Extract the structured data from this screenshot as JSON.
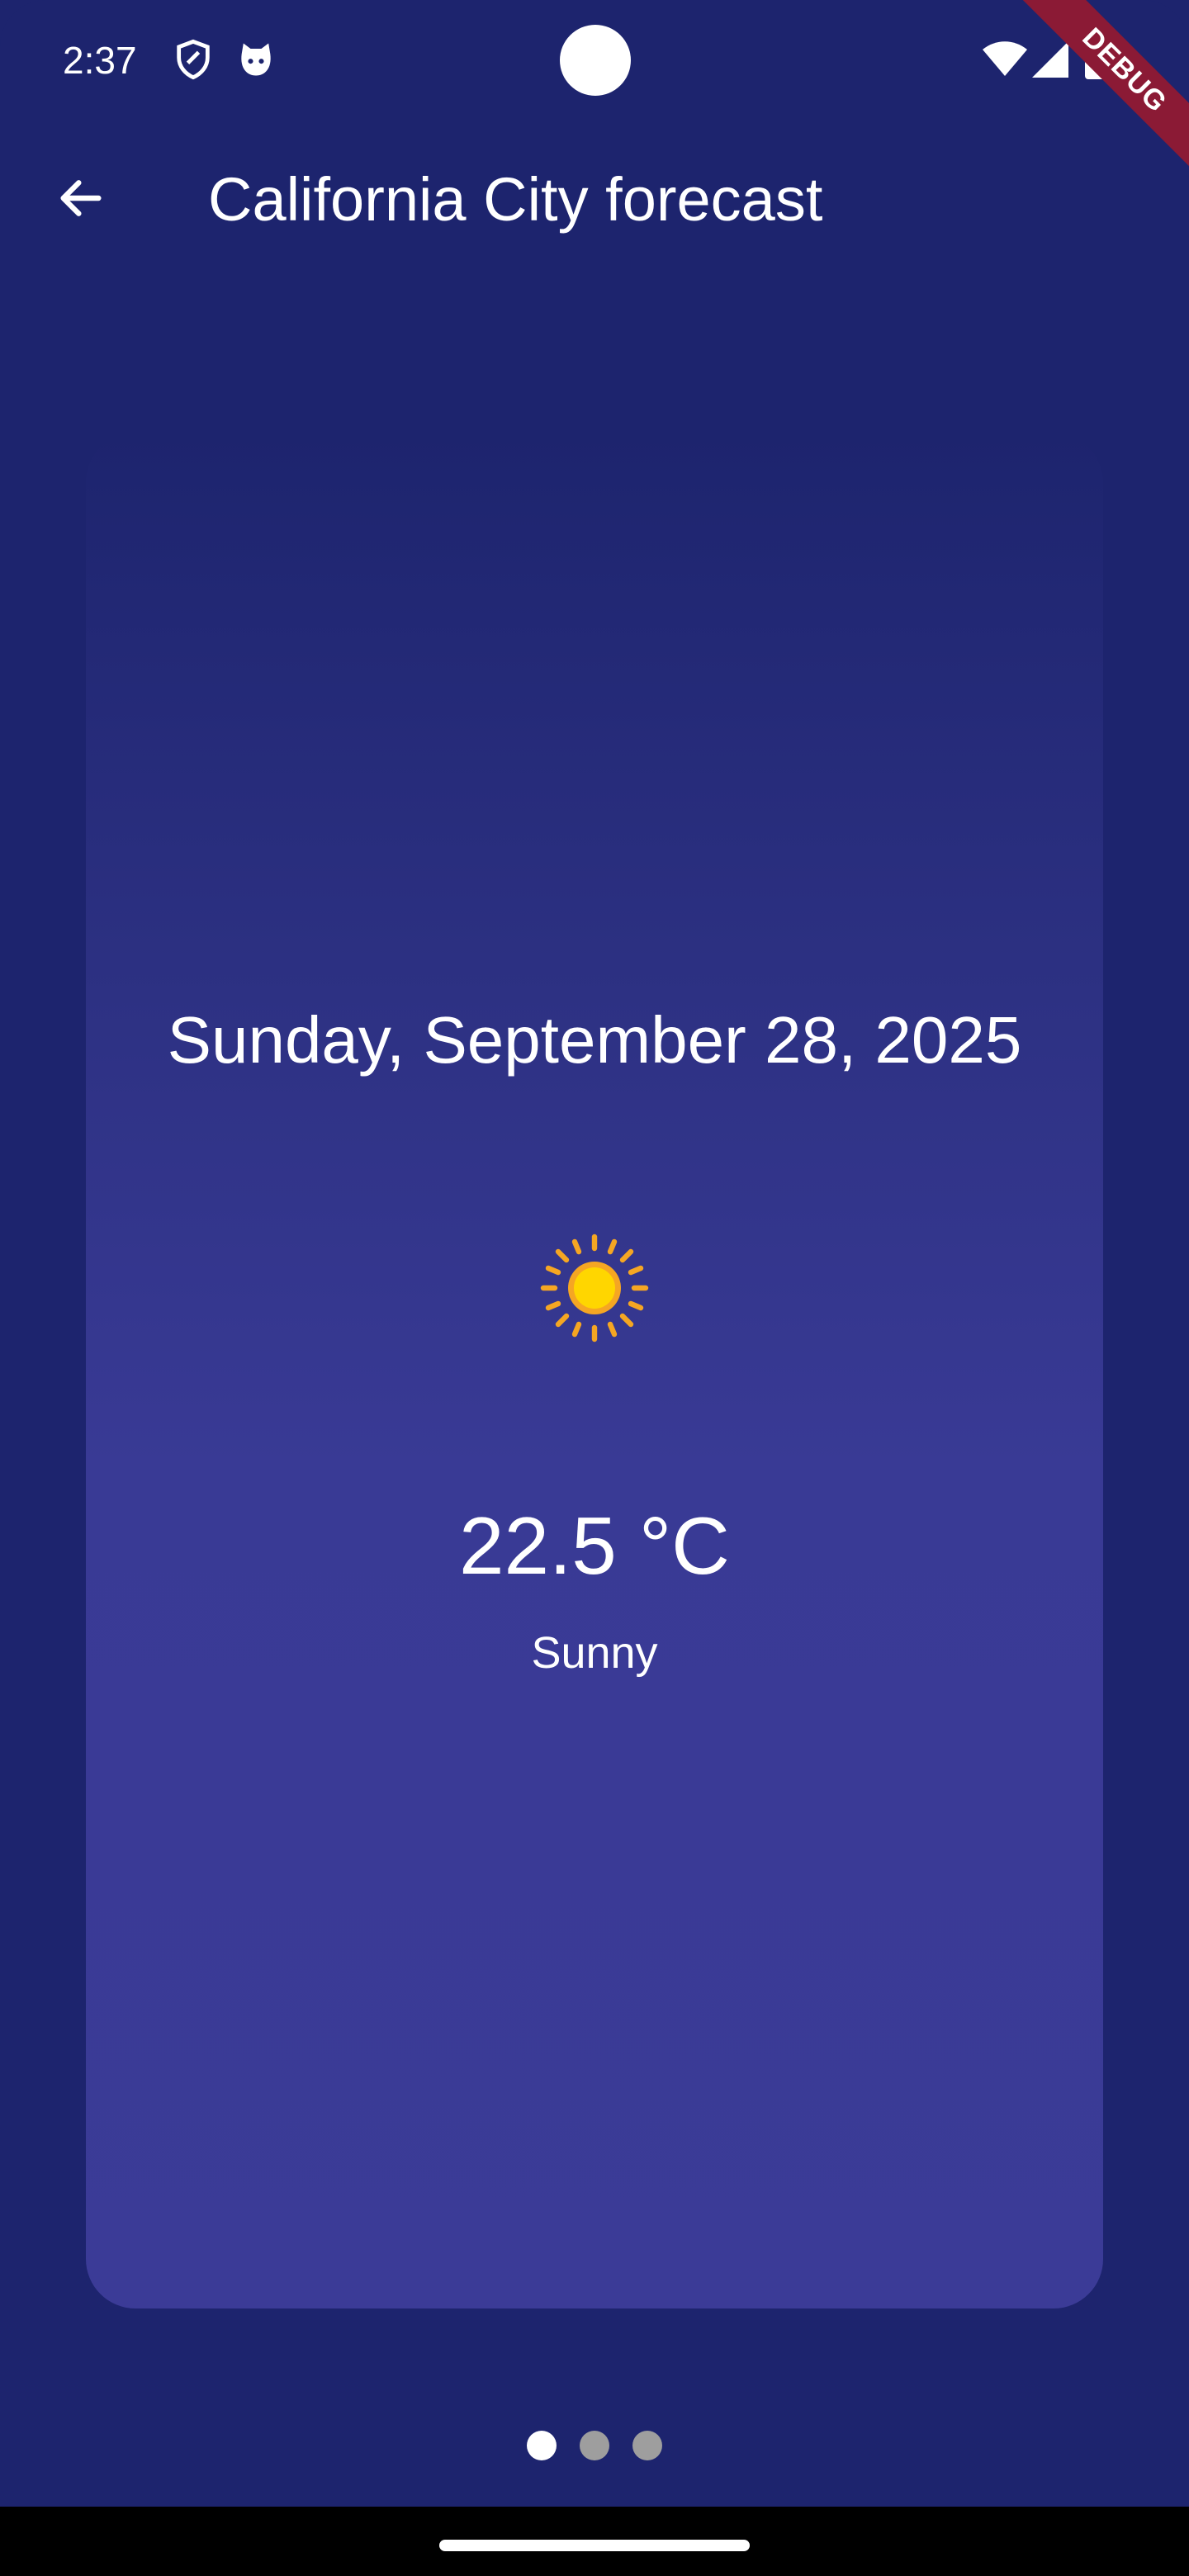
{
  "status_bar": {
    "time": "2:37",
    "left_icons": [
      "shield-icon",
      "cat-face-icon"
    ],
    "right_icons": [
      "wifi-icon",
      "cellular-signal-icon",
      "battery-icon"
    ]
  },
  "debug_banner": {
    "label": "DEBUG",
    "color": "#8b1a35"
  },
  "app_bar": {
    "back_icon": "arrow-back-icon",
    "title": "California City forecast"
  },
  "forecast": {
    "date": "Sunday, September 28, 2025",
    "weather_icon": "sun-icon",
    "temperature": "22.5 °C",
    "condition": "Sunny"
  },
  "pager": {
    "page_count": 3,
    "active_index": 0
  },
  "colors": {
    "background": "#1d246e",
    "card_bottom": "#3b3b97",
    "text": "#ffffff",
    "dot_inactive": "#9e9e9e",
    "dot_active": "#ffffff",
    "sun_core": "#ffd600",
    "sun_rays": "#f5a623"
  }
}
